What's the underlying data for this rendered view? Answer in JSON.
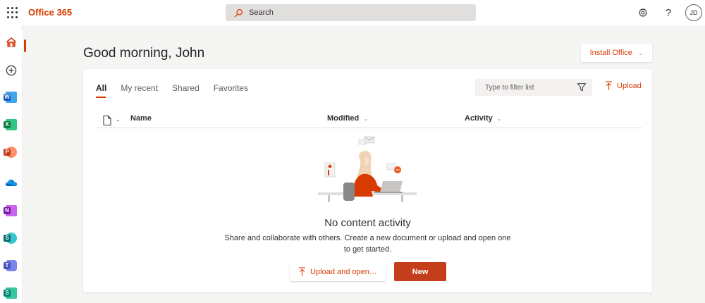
{
  "app": {
    "brand": "Office 365",
    "brand_color": "#d83b01"
  },
  "topbar": {
    "search_placeholder": "Search",
    "help_label": "?",
    "avatar_initials": "JD",
    "icons": [
      "waffle-icon",
      "search-icon",
      "gear-icon",
      "help-icon"
    ]
  },
  "rail": {
    "items": [
      {
        "name": "home",
        "icon": "home-icon",
        "active": true
      },
      {
        "name": "create",
        "icon": "plus-circle-icon"
      },
      {
        "name": "word",
        "icon": "word-icon",
        "letter": "W",
        "color": "#185abd"
      },
      {
        "name": "excel",
        "icon": "excel-icon",
        "letter": "X",
        "color": "#107c41"
      },
      {
        "name": "powerpoint",
        "icon": "powerpoint-icon",
        "letter": "P",
        "color": "#c43e1c"
      },
      {
        "name": "onedrive",
        "icon": "onedrive-icon",
        "color": "#0364b8"
      },
      {
        "name": "onenote",
        "icon": "onenote-icon",
        "letter": "N",
        "color": "#7719aa"
      },
      {
        "name": "sharepoint",
        "icon": "sharepoint-icon",
        "letter": "S",
        "color": "#036c70"
      },
      {
        "name": "teams",
        "icon": "teams-icon",
        "letter": "T",
        "color": "#4b53bc"
      },
      {
        "name": "sway",
        "icon": "sway-icon",
        "letter": "S",
        "color": "#008272"
      }
    ]
  },
  "main": {
    "greeting": "Good morning, John",
    "install_label": "Install Office",
    "tabs": [
      {
        "label": "All",
        "active": true
      },
      {
        "label": "My recent"
      },
      {
        "label": "Shared"
      },
      {
        "label": "Favorites"
      }
    ],
    "filter_placeholder": "Type to filter list",
    "upload_label": "Upload",
    "columns": {
      "name": "Name",
      "modified": "Modified",
      "activity": "Activity"
    },
    "empty": {
      "title": "No content activity",
      "description": "Share and collaborate with others. Create a new document or upload and open one to get started."
    },
    "buttons": {
      "upload_open": "Upload and open…",
      "new": "New"
    }
  },
  "colors": {
    "accent": "#d83b01",
    "new_button": "#c43e1c",
    "background": "#f5f5f4"
  }
}
